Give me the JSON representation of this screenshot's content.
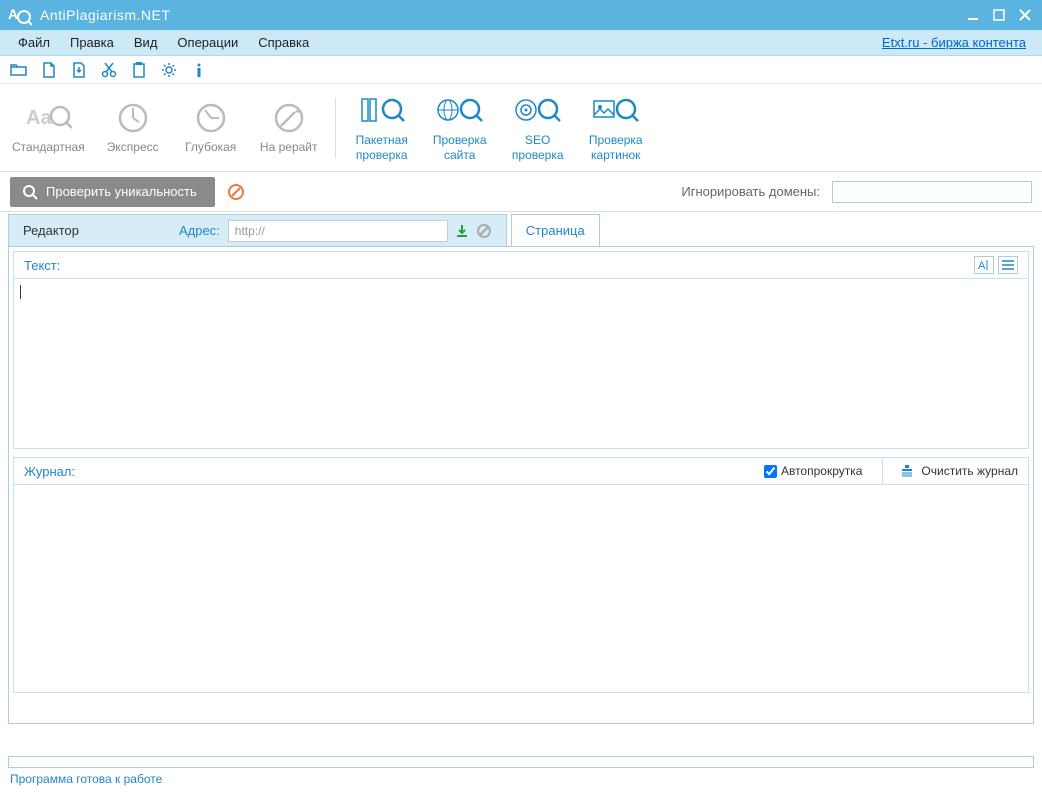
{
  "app": {
    "title": "AntiPlagiarism.NET"
  },
  "menu": {
    "file": "Файл",
    "edit": "Правка",
    "view": "Вид",
    "operations": "Операции",
    "help": "Справка",
    "link": "Etxt.ru - биржа контента"
  },
  "ribbon": {
    "standard": "Стандартная",
    "express": "Экспресс",
    "deep": "Глубокая",
    "rewrite": "На рерайт",
    "batch": "Пакетная\nпроверка",
    "site": "Проверка\nсайта",
    "seo": "SEO\nпроверка",
    "images": "Проверка\nкартинок"
  },
  "actions": {
    "check_uniqueness": "Проверить уникальность",
    "ignore_domains": "Игнорировать домены:",
    "ignore_value": ""
  },
  "tabs": {
    "editor": "Редактор",
    "address_label": "Адрес:",
    "address_value": "http://",
    "page": "Страница"
  },
  "editor": {
    "text_label": "Текст:",
    "text_value": ""
  },
  "log": {
    "label": "Журнал:",
    "autoscroll": "Автопрокрутка",
    "autoscroll_checked": true,
    "clear": "Очистить журнал"
  },
  "status": {
    "text": "Программа готова к работе"
  }
}
